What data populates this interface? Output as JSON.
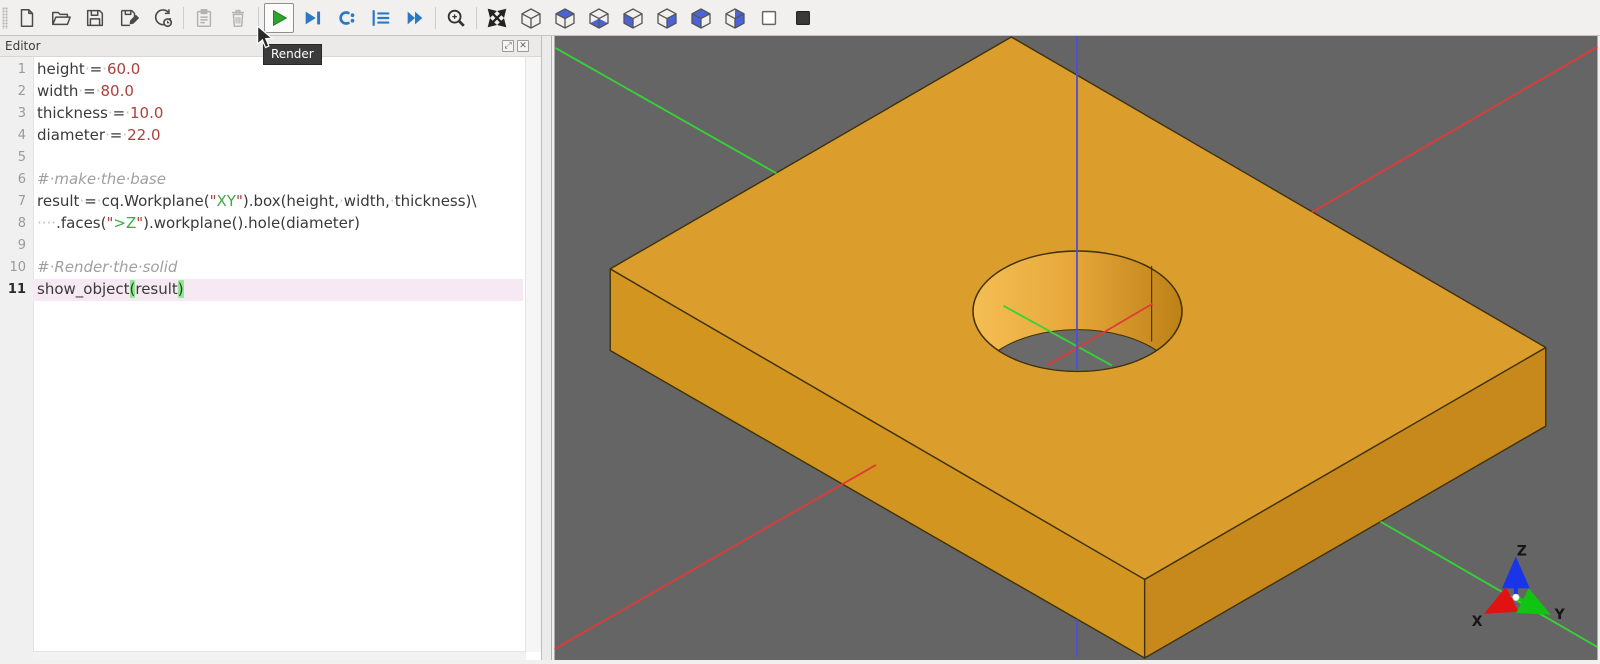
{
  "toolbar": {
    "render_tooltip": "Render",
    "buttons": [
      {
        "name": "new-file"
      },
      {
        "name": "open-file"
      },
      {
        "name": "save"
      },
      {
        "name": "save-as"
      },
      {
        "name": "reload"
      },
      {
        "name": "paste",
        "disabled": true
      },
      {
        "name": "delete",
        "disabled": true
      },
      {
        "name": "render",
        "hovered": true
      },
      {
        "name": "debug-step"
      },
      {
        "name": "debug-step-into"
      },
      {
        "name": "debug-stack"
      },
      {
        "name": "debug-continue"
      },
      {
        "name": "zoom-fit"
      },
      {
        "name": "fit-all"
      },
      {
        "name": "view-iso"
      },
      {
        "name": "view-top"
      },
      {
        "name": "view-bottom"
      },
      {
        "name": "view-front"
      },
      {
        "name": "view-back"
      },
      {
        "name": "view-left"
      },
      {
        "name": "view-right"
      },
      {
        "name": "wireframe-mode"
      },
      {
        "name": "shaded-mode"
      }
    ]
  },
  "editor": {
    "title": "Editor",
    "current_line": 11,
    "lines": [
      {
        "n": "1",
        "tokens": [
          [
            "p",
            "height"
          ],
          [
            "w",
            "·"
          ],
          [
            "p",
            "="
          ],
          [
            "w",
            "·"
          ],
          [
            "n",
            "60.0"
          ]
        ]
      },
      {
        "n": "2",
        "tokens": [
          [
            "p",
            "width"
          ],
          [
            "w",
            "·"
          ],
          [
            "p",
            "="
          ],
          [
            "w",
            "·"
          ],
          [
            "n",
            "80.0"
          ]
        ]
      },
      {
        "n": "3",
        "tokens": [
          [
            "p",
            "thickness"
          ],
          [
            "w",
            "·"
          ],
          [
            "p",
            "="
          ],
          [
            "w",
            "·"
          ],
          [
            "n",
            "10.0"
          ]
        ]
      },
      {
        "n": "4",
        "tokens": [
          [
            "p",
            "diameter"
          ],
          [
            "w",
            "·"
          ],
          [
            "p",
            "="
          ],
          [
            "w",
            "·"
          ],
          [
            "n",
            "22.0"
          ]
        ]
      },
      {
        "n": "5",
        "tokens": []
      },
      {
        "n": "6",
        "tokens": [
          [
            "c",
            "#·make·the·base"
          ]
        ]
      },
      {
        "n": "7",
        "tokens": [
          [
            "p",
            "result"
          ],
          [
            "w",
            "·"
          ],
          [
            "p",
            "="
          ],
          [
            "w",
            "·"
          ],
          [
            "p",
            "cq.Workplane("
          ],
          [
            "q",
            "\""
          ],
          [
            "s",
            "XY"
          ],
          [
            "q",
            "\""
          ],
          [
            "p",
            ").box(height,"
          ],
          [
            "w",
            "·"
          ],
          [
            "p",
            "width,"
          ],
          [
            "w",
            "·"
          ],
          [
            "p",
            "thickness)\\"
          ]
        ]
      },
      {
        "n": "8",
        "tokens": [
          [
            "w",
            "····"
          ],
          [
            "p",
            ".faces("
          ],
          [
            "q",
            "\""
          ],
          [
            "s",
            ">Z"
          ],
          [
            "q",
            "\""
          ],
          [
            "p",
            ").workplane().hole(diameter)"
          ]
        ]
      },
      {
        "n": "9",
        "tokens": []
      },
      {
        "n": "10",
        "tokens": [
          [
            "c",
            "#·Render·the·solid"
          ]
        ]
      },
      {
        "n": "11",
        "tokens": [
          [
            "p",
            "show_object"
          ],
          [
            "b",
            "("
          ],
          [
            "p",
            "result"
          ],
          [
            "b",
            ")"
          ]
        ]
      }
    ]
  },
  "viewport": {
    "triad": {
      "x": "X",
      "y": "Y",
      "z": "Z"
    },
    "colors": {
      "background": "#656565",
      "object_top": "#DB9E2C",
      "object_left": "#D2951F",
      "object_right": "#C8891C",
      "hole_wall_light": "#F4BE55",
      "hole_wall_dark": "#BE8117",
      "hole_through": "#6A6A6A",
      "edge": "#3F3208",
      "axis_x": "#E03A36",
      "axis_y": "#35D435",
      "axis_z": "#4D4DDD",
      "triad_x": "#E01212",
      "triad_y": "#12C412",
      "triad_z": "#1A35E8"
    }
  }
}
